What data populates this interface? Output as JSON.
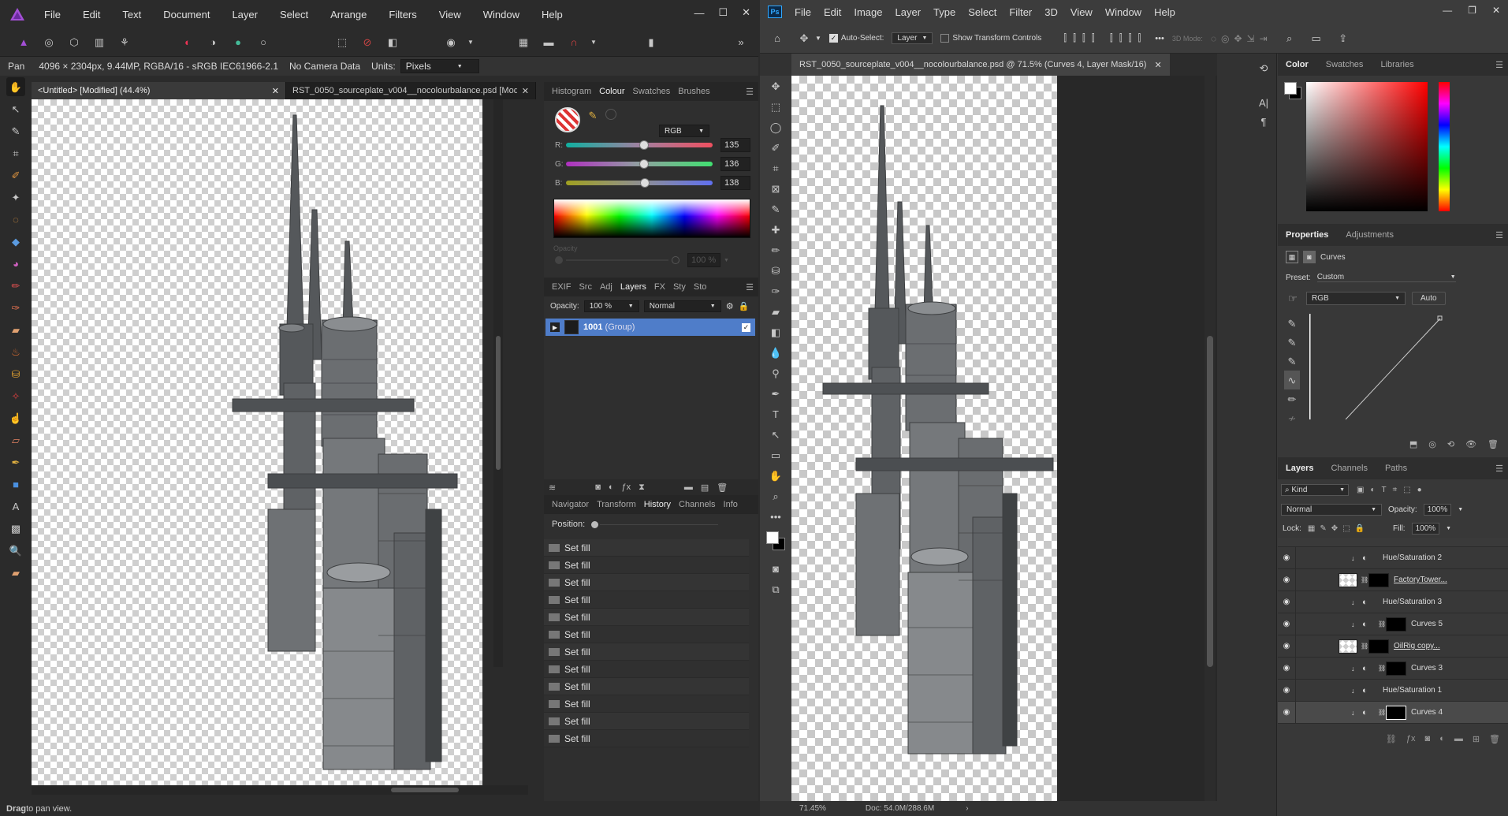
{
  "affinity": {
    "menu": [
      "File",
      "Edit",
      "Text",
      "Document",
      "Layer",
      "Select",
      "Arrange",
      "Filters",
      "View",
      "Window",
      "Help"
    ],
    "context": {
      "tool": "Pan",
      "info": "4096 × 2304px, 9.44MP, RGBA/16 - sRGB IEC61966-2.1",
      "camera": "No Camera Data",
      "units_label": "Units:",
      "units_value": "Pixels"
    },
    "doc_tabs": [
      "<Untitled> [Modified] (44.4%)",
      "RST_0050_sourceplate_v004__nocolourbalance.psd [Modi..."
    ],
    "tab_close": "✕",
    "colour_tabs": [
      "Histogram",
      "Colour",
      "Swatches",
      "Brushes"
    ],
    "colour_mode": "RGB",
    "rgb": {
      "r_label": "R:",
      "g_label": "G:",
      "b_label": "B:",
      "r": "135",
      "g": "136",
      "b": "138",
      "r_frac": 0.53,
      "g_frac": 0.53,
      "b_frac": 0.54
    },
    "opacity_caption": "Opacity",
    "opacity_slider_value": "100 %",
    "layers_tabs": [
      "EXIF",
      "Src",
      "Adj",
      "Layers",
      "FX",
      "Sty",
      "Sto"
    ],
    "layers_opacity_label": "Opacity:",
    "layers_opacity": "100 %",
    "layers_blend": "Normal",
    "layer_name": "1001",
    "layer_type": "(Group)",
    "history_tabs": [
      "Navigator",
      "Transform",
      "History",
      "Channels",
      "Info"
    ],
    "position_label": "Position:",
    "history": [
      "Set fill",
      "Set fill",
      "Set fill",
      "Set fill",
      "Set fill",
      "Set fill",
      "Set fill",
      "Set fill",
      "Set fill",
      "Set fill",
      "Set fill",
      "Set fill"
    ],
    "status_bold": "Drag",
    "status_text": " to pan view."
  },
  "photoshop": {
    "logo": "Ps",
    "menu": [
      "File",
      "Edit",
      "Image",
      "Layer",
      "Type",
      "Select",
      "Filter",
      "3D",
      "View",
      "Window",
      "Help"
    ],
    "auto_select_label": "Auto-Select:",
    "auto_select_value": "Layer",
    "show_transform_label": "Show Transform Controls",
    "mode_3d": "3D Mode:",
    "doc_tab": "RST_0050_sourceplate_v004__nocolourbalance.psd @ 71.5% (Curves 4, Layer Mask/16)",
    "doc_tab_close": "✕",
    "color_tabs": [
      "Color",
      "Swatches",
      "Libraries"
    ],
    "properties_tabs": [
      "Properties",
      "Adjustments"
    ],
    "properties_title": "Curves",
    "preset_label": "Preset:",
    "preset_value": "Custom",
    "channel_value": "RGB",
    "auto_label": "Auto",
    "layers_tabs": [
      "Layers",
      "Channels",
      "Paths"
    ],
    "kind_label": "Kind",
    "blend_mode": "Normal",
    "opacity_label": "Opacity:",
    "opacity_value": "100%",
    "lock_label": "Lock:",
    "fill_label": "Fill:",
    "fill_value": "100%",
    "layers": [
      {
        "name": "Hue/Saturation 2",
        "type": "adjust",
        "thumb": false,
        "mask": false
      },
      {
        "name": "FactoryTower...",
        "type": "pixel",
        "thumb": true,
        "mask": true
      },
      {
        "name": "Hue/Saturation 3",
        "type": "adjust",
        "thumb": false,
        "mask": false
      },
      {
        "name": "Curves 5",
        "type": "adjust",
        "thumb": false,
        "mask": true
      },
      {
        "name": "OilRig copy...",
        "type": "pixel",
        "thumb": true,
        "mask": true
      },
      {
        "name": "Curves 3",
        "type": "adjust",
        "thumb": false,
        "mask": true
      },
      {
        "name": "Hue/Saturation 1",
        "type": "adjust",
        "thumb": false,
        "mask": false
      },
      {
        "name": "Curves 4",
        "type": "adjust",
        "thumb": false,
        "mask": true,
        "selected": true
      }
    ],
    "status_zoom": "71.45%",
    "status_doc": "Doc: 54.0M/288.6M",
    "colors": {
      "accent": "#4f7dc9",
      "panel": "#383838"
    }
  }
}
